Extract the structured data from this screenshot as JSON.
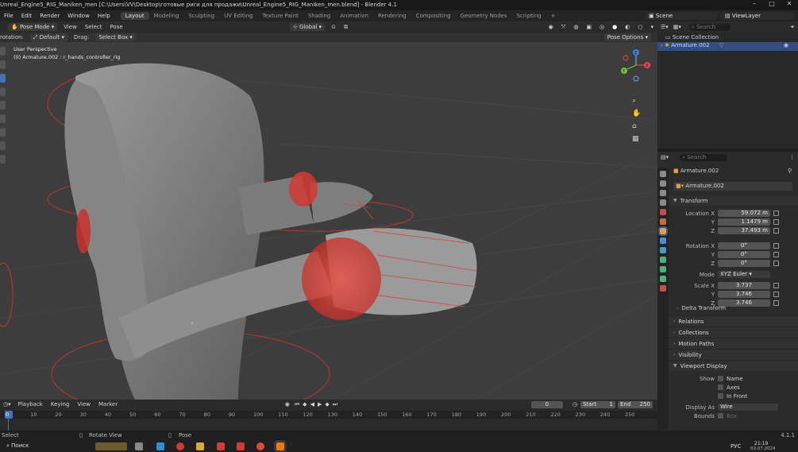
{
  "titlebar": {
    "title": "Unreal_Engine5_RIG_Maniken_men [C:\\Users\\VV\\Desktop\\готовые риги для продажи\\Unreal_Engine5_RIG_Maniken_men.blend] - Blender 4.1"
  },
  "menu": {
    "items": [
      "File",
      "Edit",
      "Render",
      "Window",
      "Help"
    ],
    "workspaces": [
      "Layout",
      "Modeling",
      "Sculpting",
      "UV Editing",
      "Texture Paint",
      "Shading",
      "Animation",
      "Rendering",
      "Compositing",
      "Geometry Nodes",
      "Scripting"
    ],
    "active_workspace": "Layout",
    "scene": "Scene",
    "view_layer": "ViewLayer"
  },
  "viewport_header": {
    "mode": "Pose Mode",
    "menus": [
      "View",
      "Select",
      "Pose"
    ],
    "orientation_label": "rotation:",
    "orientation_value": "Default",
    "drag_label": "Drag:",
    "drag_value": "Select Box",
    "transform_orientation": "Global",
    "pose_options": "Pose Options"
  },
  "viewport": {
    "view_name": "User Perspective",
    "active_object": "(0) Armature.002 : r_hands_controller_rig",
    "gizmo_axes": [
      "X",
      "Y",
      "Z"
    ]
  },
  "outliner": {
    "search_placeholder": "Search",
    "collection": "Scene Collection",
    "item": "Armature.002"
  },
  "properties": {
    "search_placeholder": "Search",
    "object_name": "Armature.002",
    "data_name": "Armature.002",
    "transform_label": "Transform",
    "location": {
      "label": "Location X",
      "x": "59.072 m",
      "y": "1.1479 m",
      "z": "37.493 m"
    },
    "rotation": {
      "label": "Rotation X",
      "x": "0°",
      "y": "0°",
      "z": "0°"
    },
    "mode": {
      "label": "Mode",
      "value": "XYZ Euler"
    },
    "scale": {
      "label": "Scale X",
      "x": "3.737",
      "y": "3.746",
      "z": "3.746"
    },
    "axis_y": "Y",
    "axis_z": "Z",
    "delta_transform": "Delta Transform",
    "panels": [
      "Relations",
      "Collections",
      "Motion Paths",
      "Visibility",
      "Viewport Display"
    ],
    "show_label": "Show",
    "show_options": [
      "Name",
      "Axes",
      "In Front"
    ],
    "display_as_label": "Display As",
    "display_as_value": "Wire",
    "bounds_label": "Bounds",
    "bounds_value": "Box"
  },
  "timeline": {
    "menus": [
      "Playback",
      "Keying",
      "View",
      "Marker"
    ],
    "current_frame": "0",
    "start_label": "Start",
    "start_value": "1",
    "end_label": "End",
    "end_value": "250",
    "frame_numbers": [
      "0",
      "10",
      "20",
      "30",
      "40",
      "50",
      "60",
      "70",
      "80",
      "90",
      "100",
      "110",
      "120",
      "130",
      "140",
      "150",
      "160",
      "170",
      "180",
      "190",
      "200",
      "210",
      "220",
      "230",
      "240",
      "250"
    ]
  },
  "statusbar": {
    "select": "Select",
    "rotate": "Rotate View",
    "pose": "Pose",
    "version": "4.1.1"
  },
  "taskbar": {
    "search": "Поиск",
    "lang": "РУС",
    "time": "21:19",
    "date": "03.07.2024"
  },
  "colors": {
    "accent": "#4772b3",
    "rig_red": "#e0342c",
    "viewport_bg": "#3d3d3d"
  }
}
